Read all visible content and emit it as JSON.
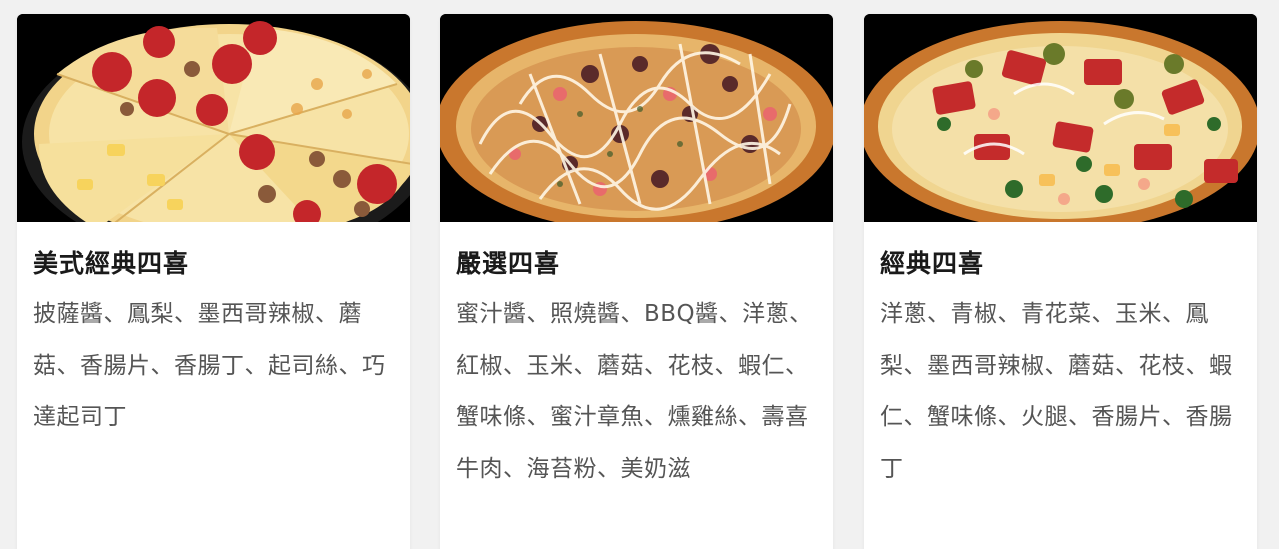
{
  "products": [
    {
      "title": "美式經典四喜",
      "description": "披薩醬、鳳梨、墨西哥辣椒、蘑菇、香腸片、香腸丁、起司絲、巧達起司丁",
      "image_name": "pizza-photo"
    },
    {
      "title": "嚴選四喜",
      "description": "蜜汁醬、照燒醬、BBQ醬、洋蔥、紅椒、玉米、蘑菇、花枝、蝦仁、蟹味條、蜜汁章魚、燻雞絲、壽喜牛肉、海苔粉、美奶滋",
      "image_name": "pizza-photo"
    },
    {
      "title": "經典四喜",
      "description": "洋蔥、青椒、青花菜、玉米、鳳梨、墨西哥辣椒、蘑菇、花枝、蝦仁、蟹味條、火腿、香腸片、香腸丁",
      "image_name": "pizza-photo"
    }
  ],
  "colors": {
    "card_background": "#ffffff",
    "page_background": "#f1f1f1",
    "title_color": "#1a1a1a",
    "text_color": "#555555",
    "photo_background": "#000000"
  }
}
